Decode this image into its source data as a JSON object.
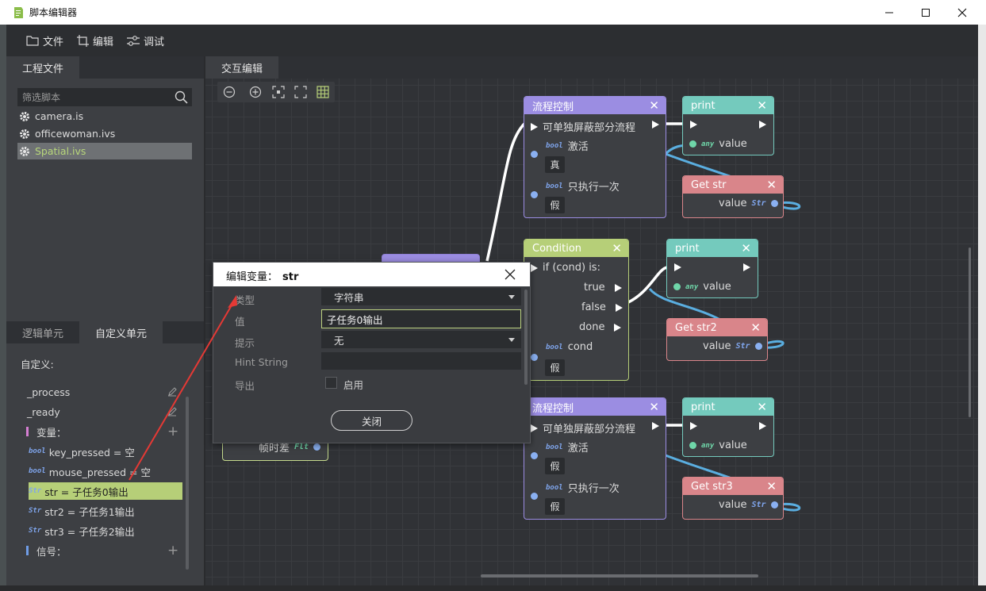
{
  "window": {
    "title": "脚本编辑器"
  },
  "menu": {
    "file": "文件",
    "edit": "编辑",
    "debug": "调试"
  },
  "project": {
    "tab": "工程文件",
    "filter_placeholder": "筛选脚本",
    "files": [
      "camera.is",
      "officewoman.ivs",
      "Spatial.ivs"
    ],
    "selected_file": "Spatial.ivs"
  },
  "units": {
    "tabs": [
      "逻辑单元",
      "自定义单元"
    ],
    "custom_label": "自定义:",
    "functions": [
      "_process",
      "_ready"
    ],
    "variables_header": "变量：",
    "variables": [
      {
        "type": "bool",
        "text": "key_pressed = 空"
      },
      {
        "type": "bool",
        "text": "mouse_pressed = 空"
      },
      {
        "type": "str",
        "text": "str = 子任务0输出"
      },
      {
        "type": "str",
        "text": "str2 = 子任务1输出"
      },
      {
        "type": "str",
        "text": "str3 = 子任务2输出"
      }
    ],
    "signals_header": "信号：",
    "type_tags": {
      "bool": "bool",
      "str": "Str"
    }
  },
  "graph": {
    "tab": "交互编辑",
    "nodes": {
      "flow1": {
        "title": "流程控制",
        "exec": "可单独屏蔽部分流程",
        "activate": "激活",
        "activate_val": "真",
        "once": "只执行一次",
        "once_val": "假"
      },
      "print1": {
        "title": "print",
        "value": "value"
      },
      "getstr1": {
        "title": "Get str",
        "value": "value"
      },
      "cond": {
        "title": "Condition",
        "if": "if (cond) is:",
        "t": "true",
        "f": "false",
        "d": "done",
        "cond": "cond",
        "cond_val": "假"
      },
      "print2": {
        "title": "print",
        "value": "value"
      },
      "getstr2": {
        "title": "Get str2",
        "value": "value"
      },
      "flow2": {
        "title": "流程控制",
        "exec": "可单独屏蔽部分流程",
        "activate": "激活",
        "activate_val": "假",
        "once": "只执行一次",
        "once_val": "假"
      },
      "print3": {
        "title": "print",
        "value": "value"
      },
      "getstr3": {
        "title": "Get str3",
        "value": "value"
      },
      "partial": {
        "text": "帧时差"
      }
    },
    "type_tags": {
      "any": "any",
      "str": "Str",
      "bool": "bool",
      "flt": "Flt"
    }
  },
  "dialog": {
    "title_prefix": "编辑变量：",
    "title_var": "str",
    "labels": {
      "type": "类型",
      "value": "值",
      "hint": "提示",
      "hint_string": "Hint String",
      "export": "导出"
    },
    "type_value": "字符串",
    "value": "子任务0输出",
    "hint_value": "无",
    "hint_string_value": "",
    "export_label": "启用",
    "close": "关闭"
  },
  "colors": {
    "flow_header": "#9b8de2",
    "print_header": "#74cabd",
    "getstr_header": "#d9858a",
    "condition_header": "#b6cf78",
    "selection": "#b6cf78",
    "annotation_arrow": "#e53935"
  }
}
